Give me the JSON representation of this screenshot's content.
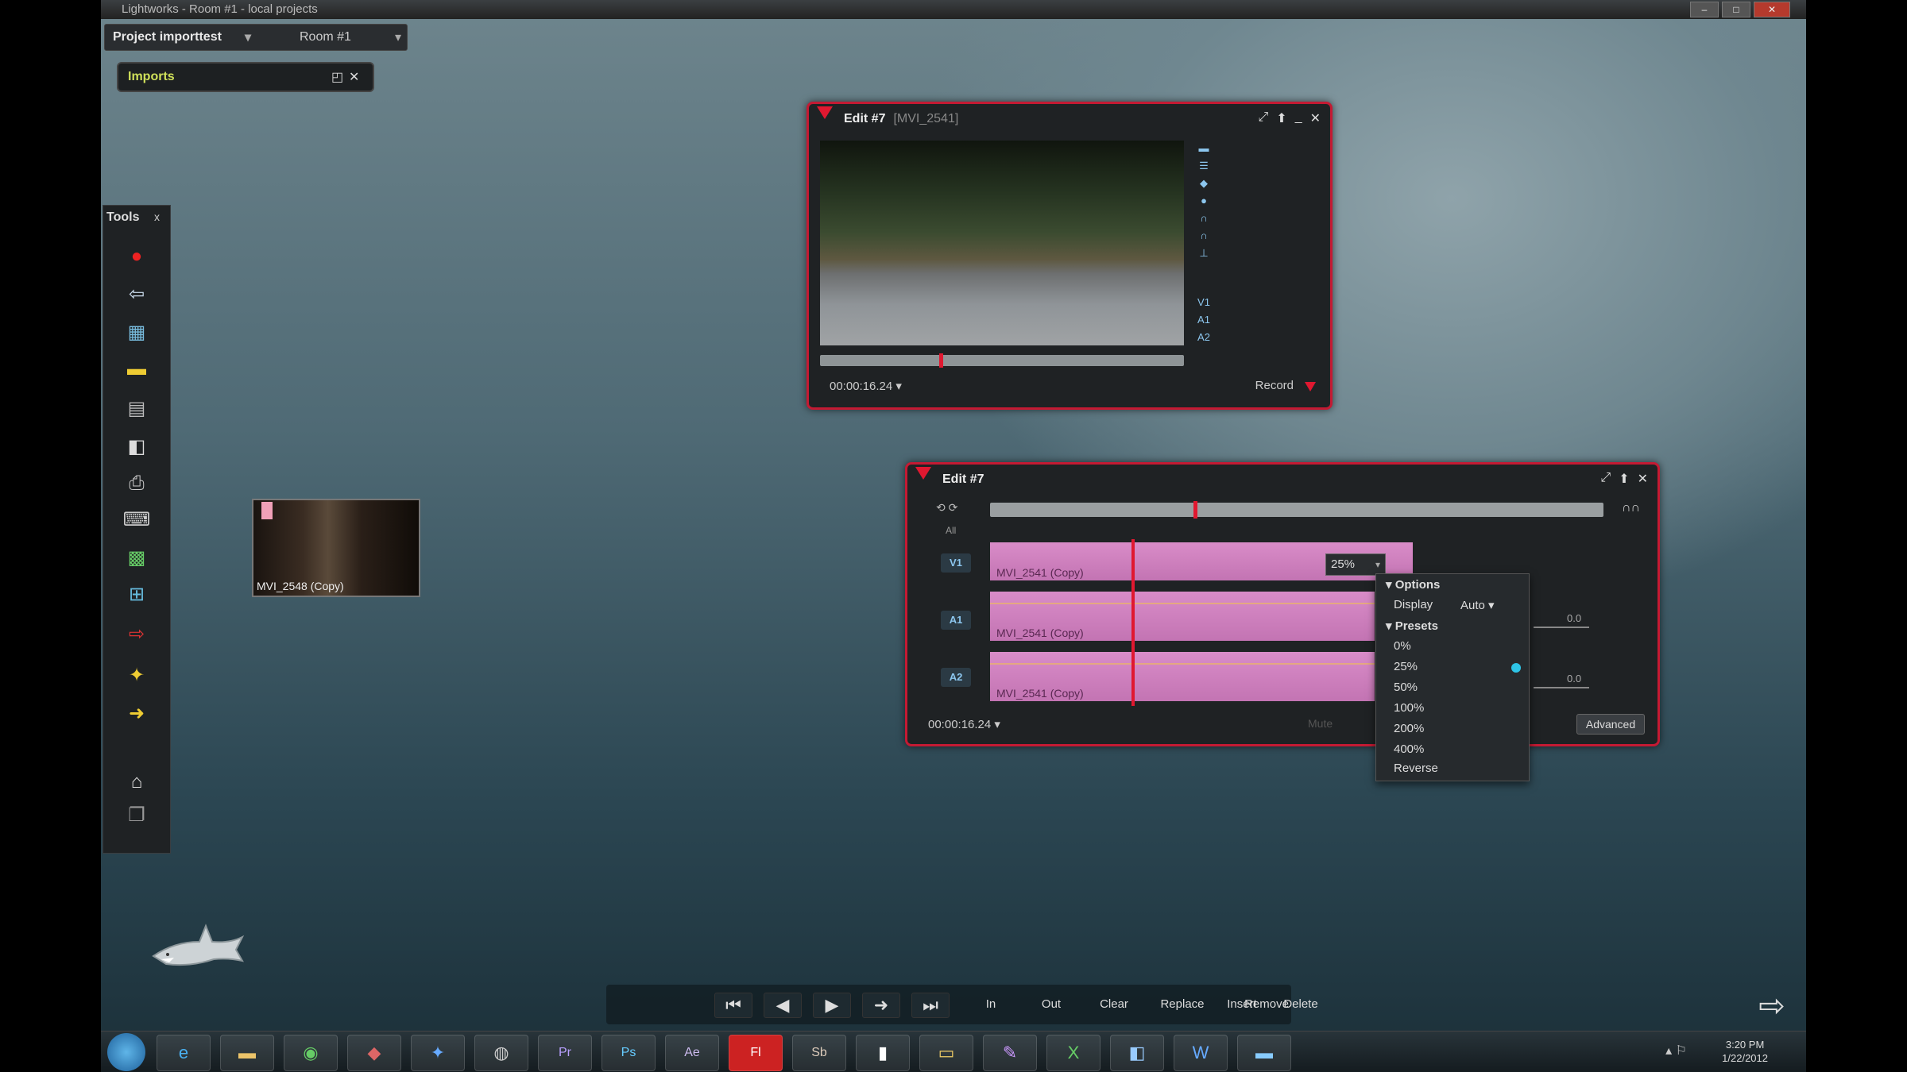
{
  "window": {
    "title": "Lightworks - Room #1 - local projects"
  },
  "project_bar": {
    "project": "Project importtest",
    "room": "Room #1"
  },
  "imports": {
    "label": "Imports"
  },
  "tools": {
    "title": "Tools",
    "close": "x"
  },
  "clip_bin": {
    "caption": "MVI_2548 (Copy)"
  },
  "viewer": {
    "title": "Edit #7",
    "subtitle": "[MVI_2541]",
    "timecode": "00:00:16.24",
    "record_label": "Record",
    "tracks": [
      "V1",
      "A1",
      "A2"
    ]
  },
  "edit": {
    "title": "Edit #7",
    "all_label": "All",
    "timecode": "00:00:16.24",
    "mute_label": "Mute",
    "advanced_label": "Advanced",
    "zoom_value": "25%",
    "tracks": [
      {
        "label": "V1",
        "clip": "MVI_2541 (Copy)"
      },
      {
        "label": "A1",
        "clip": "MVI_2541 (Copy)"
      },
      {
        "label": "A2",
        "clip": "MVI_2541 (Copy)"
      }
    ],
    "volume_a1": "0.0",
    "volume_a2": "0.0"
  },
  "zoom_menu": {
    "options_header": "Options",
    "display_label": "Display",
    "display_value": "Auto",
    "presets_header": "Presets",
    "presets": [
      "0%",
      "25%",
      "50%",
      "100%",
      "200%",
      "400%"
    ],
    "selected": "25%",
    "reverse_label": "Reverse"
  },
  "transport": {
    "buttons": [
      "In",
      "Out",
      "Clear",
      "Replace",
      "Insert",
      "Delete",
      "Remove"
    ]
  },
  "taskbar": {
    "clock_time": "3:20 PM",
    "clock_date": "1/22/2012"
  },
  "colors": {
    "accent_red": "#c41a33",
    "clip_pink": "#d98cc8",
    "selected_cyan": "#2ec4e6"
  }
}
